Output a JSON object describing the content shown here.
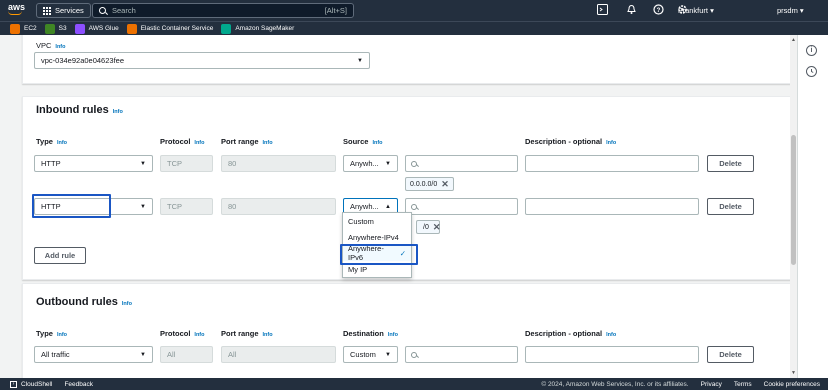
{
  "topnav": {
    "logo": "aws",
    "services_label": "Services",
    "search_placeholder": "Search",
    "search_shortcut": "[Alt+S]",
    "region": "Frankfurt ▾",
    "user": "prsdm ▾"
  },
  "favorites": [
    {
      "label": "EC2",
      "color": "#ed7100"
    },
    {
      "label": "S3",
      "color": "#3f8624"
    },
    {
      "label": "AWS Glue",
      "color": "#8c4fff"
    },
    {
      "label": "Elastic Container Service",
      "color": "#ed7100"
    },
    {
      "label": "Amazon SageMaker",
      "color": "#01a88d"
    }
  ],
  "vpc": {
    "label": "VPC",
    "info": "Info",
    "value": "vpc-034e92a0e04623fee"
  },
  "inbound": {
    "title": "Inbound rules",
    "info": "Info",
    "headers": {
      "type": "Type",
      "protocol": "Protocol",
      "port_range": "Port range",
      "source": "Source",
      "description": "Description - optional"
    },
    "rows": [
      {
        "type": "HTTP",
        "protocol": "TCP",
        "port": "80",
        "source": "Anywh...",
        "token": "0.0.0.0/0",
        "delete": "Delete"
      },
      {
        "type": "HTTP",
        "protocol": "TCP",
        "port": "80",
        "source": "Anywh...",
        "token": "/0",
        "delete": "Delete"
      }
    ],
    "add_rule": "Add rule",
    "dropdown_options": [
      "Custom",
      "Anywhere-IPv4",
      "Anywhere-IPv6",
      "My IP"
    ],
    "selected_option": "Anywhere-IPv6"
  },
  "outbound": {
    "title": "Outbound rules",
    "info": "Info",
    "headers": {
      "type": "Type",
      "protocol": "Protocol",
      "port_range": "Port range",
      "destination": "Destination",
      "description": "Description - optional"
    },
    "row": {
      "type": "All traffic",
      "protocol": "All",
      "port": "All",
      "destination": "Custom",
      "delete": "Delete"
    }
  },
  "footer": {
    "cloudshell": "CloudShell",
    "feedback": "Feedback",
    "copyright": "© 2024, Amazon Web Services, Inc. or its affiliates.",
    "privacy": "Privacy",
    "terms": "Terms",
    "cookies": "Cookie preferences"
  }
}
